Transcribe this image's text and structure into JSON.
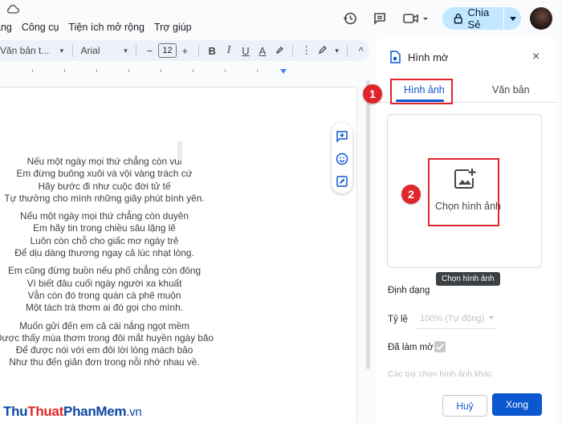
{
  "menu_bar": {
    "items": [
      "ang",
      "Công cụ",
      "Tiện ích mở rộng",
      "Trợ giúp"
    ]
  },
  "header": {
    "share_label": "Chia Sẻ"
  },
  "format_toolbar": {
    "style": "Văn bản t...",
    "font": "Arial",
    "size": "12",
    "minus": "−",
    "plus": "+",
    "bold": "B",
    "italic": "I",
    "underline": "U",
    "text_color": "A",
    "caret": "▾",
    "more": "⋮",
    "collapse": "^"
  },
  "document": {
    "stanzas": [
      [
        "Nếu một ngày mọi thứ chẳng còn vui",
        "Em đừng buông xuôi và vội vàng trách cứ",
        "Hãy bước đi như cuộc đời tử tế",
        "Tự thưởng cho mình những giây phút bình yên."
      ],
      [
        "Nếu một ngày mọi thứ chẳng còn duyên",
        "Em hãy tin trong chiều sâu lặng lẽ",
        "Luôn còn chỗ cho giấc mơ ngày trẻ",
        "Để dịu dàng thương ngay cả lúc nhạt lòng."
      ],
      [
        "Em cũng đừng buồn nếu phố chẳng còn đông",
        "Vì biết đâu cuối ngày người xa khuất",
        "Vẫn còn đó trong quán cà phê muộn",
        "Một tách trà thơm ai đó gọi cho mình."
      ],
      [
        "Muốn gửi đến em cả cái nắng ngọt mềm",
        "Được thấy mùa thơm trong đôi mắt huyền ngày bão",
        "Để được nói với em đôi lời lòng mách bảo",
        "Như thu đến giản đơn trong nỗi nhớ nhau về."
      ]
    ]
  },
  "watermark_panel": {
    "title": "Hình mờ",
    "close": "×",
    "tabs": [
      "Hình ảnh",
      "Văn bản"
    ],
    "active_tab": "Hình ảnh",
    "choose_image_label": "Chọn hình ảnh",
    "tooltip": "Chọn hình ảnh",
    "format_section": "Định dạng",
    "scale_label": "Tỷ lệ",
    "scale_value": "100% (Tự động)",
    "faded_label": "Đã làm mờ",
    "faded_checked": true,
    "more_options": "Các tuỳ chọn hình ảnh khác",
    "cancel": "Huỷ",
    "done": "Xong"
  },
  "annotations": {
    "badge_1": "1",
    "badge_2": "2",
    "color": "#e0262a"
  },
  "watermark_text": {
    "part1": "Thu",
    "part2": "Thuat",
    "part3": "PhanMem",
    "part4": ".vn"
  },
  "colors": {
    "accent": "#0b57d0",
    "share_bg": "#c2e7ff",
    "toolbar_bg": "#edf2fa"
  }
}
